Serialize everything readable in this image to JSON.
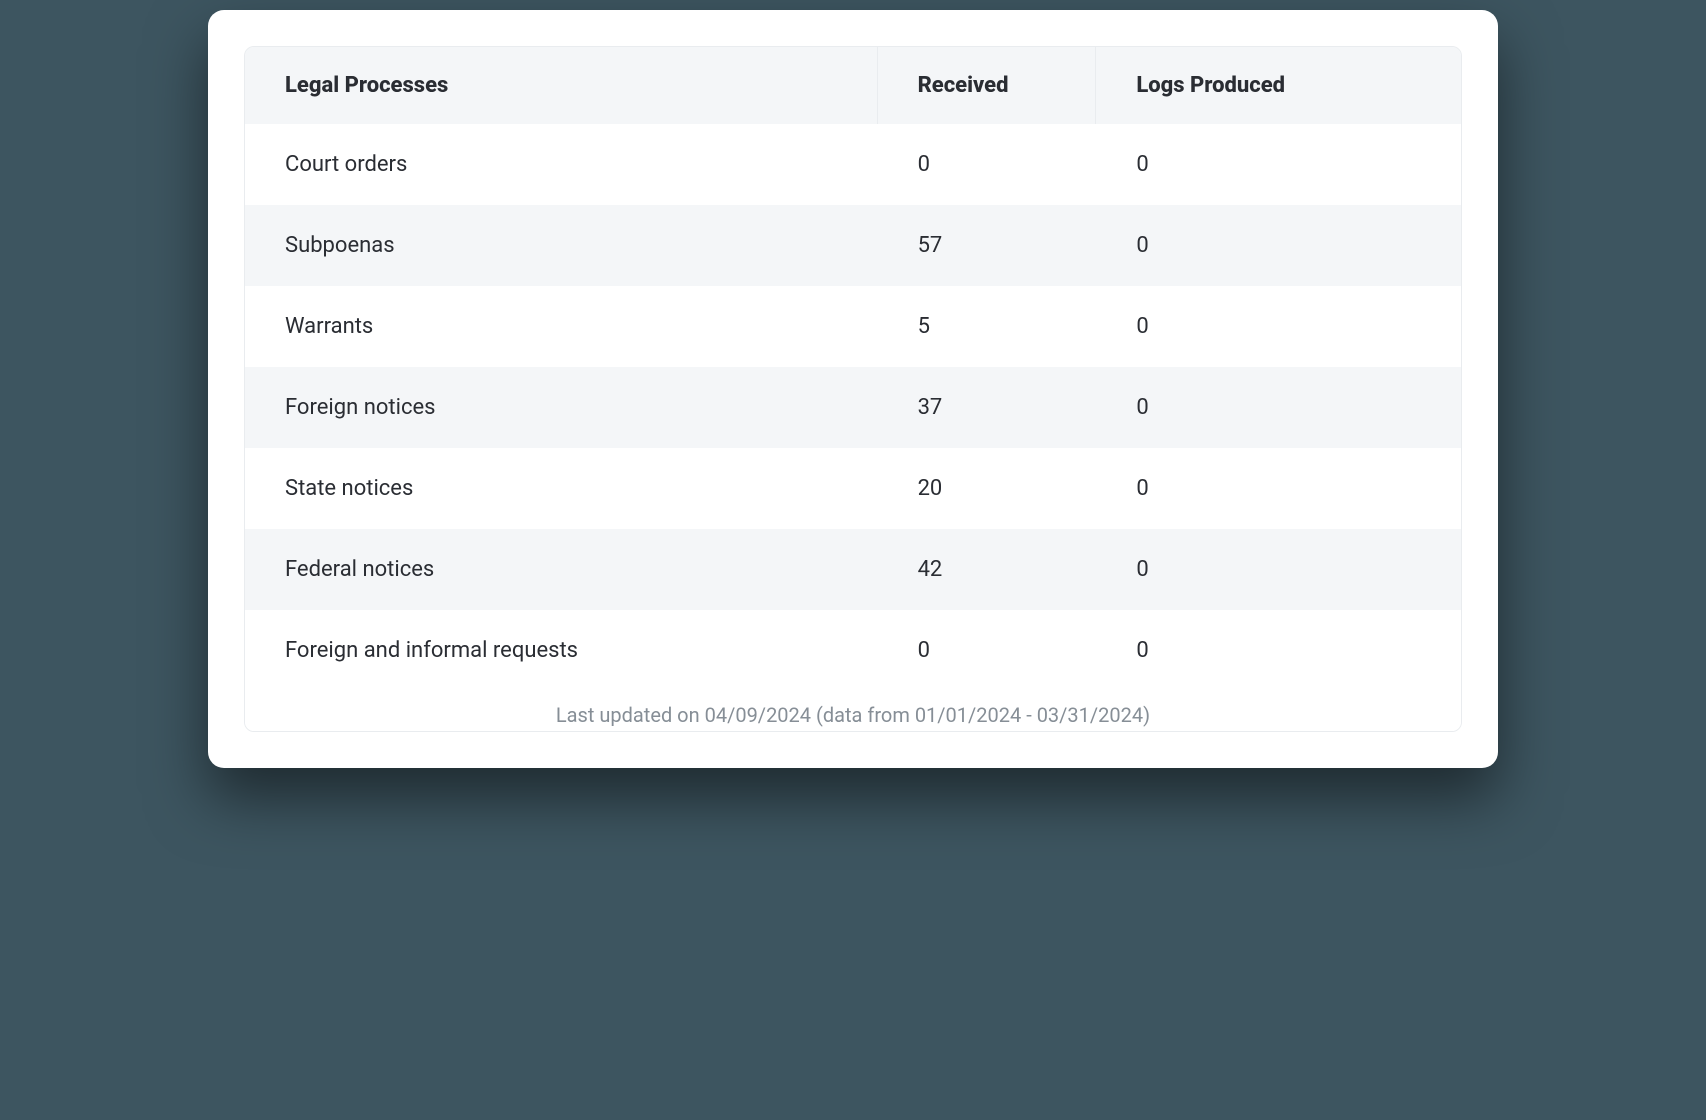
{
  "chart_data": {
    "type": "table",
    "columns": [
      "Legal Processes",
      "Received",
      "Logs Produced"
    ],
    "rows": [
      {
        "process": "Court orders",
        "received": 0,
        "logs": 0
      },
      {
        "process": "Subpoenas",
        "received": 57,
        "logs": 0
      },
      {
        "process": "Warrants",
        "received": 5,
        "logs": 0
      },
      {
        "process": "Foreign notices",
        "received": 37,
        "logs": 0
      },
      {
        "process": "State notices",
        "received": 20,
        "logs": 0
      },
      {
        "process": "Federal notices",
        "received": 42,
        "logs": 0
      },
      {
        "process": "Foreign and informal requests",
        "received": 0,
        "logs": 0
      }
    ],
    "footer": "Last updated on 04/09/2024 (data from 01/01/2024 - 03/31/2024)"
  }
}
